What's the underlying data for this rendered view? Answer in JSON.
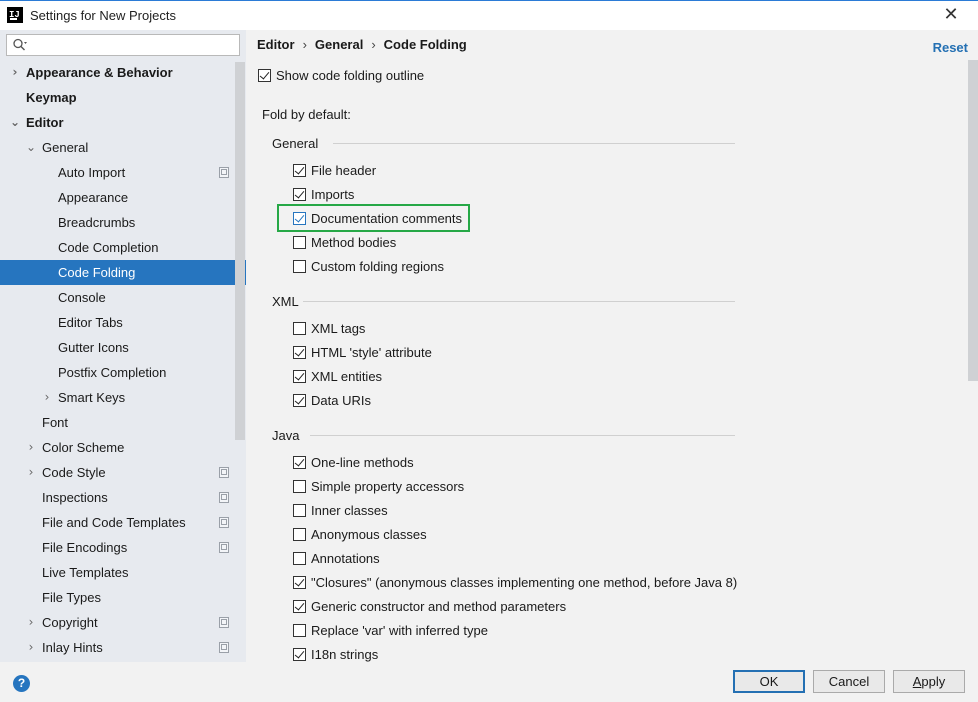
{
  "window": {
    "title": "Settings for New Projects",
    "close_glyph": "✕",
    "app_icon_text": "IJ"
  },
  "search": {
    "placeholder": ""
  },
  "tree": [
    {
      "label": "Appearance & Behavior",
      "arrow": "›",
      "bold": true
    },
    {
      "label": "Keymap",
      "bold": true
    },
    {
      "label": "Editor",
      "arrow": "⌄",
      "bold": true
    },
    {
      "label": "General",
      "arrow": "⌄"
    },
    {
      "label": "Auto Import",
      "project_icon": true
    },
    {
      "label": "Appearance"
    },
    {
      "label": "Breadcrumbs"
    },
    {
      "label": "Code Completion"
    },
    {
      "label": "Code Folding",
      "selected": true
    },
    {
      "label": "Console"
    },
    {
      "label": "Editor Tabs"
    },
    {
      "label": "Gutter Icons"
    },
    {
      "label": "Postfix Completion"
    },
    {
      "label": "Smart Keys",
      "arrow": "›"
    },
    {
      "label": "Font"
    },
    {
      "label": "Color Scheme",
      "arrow": "›"
    },
    {
      "label": "Code Style",
      "arrow": "›",
      "project_icon": true
    },
    {
      "label": "Inspections",
      "project_icon": true
    },
    {
      "label": "File and Code Templates",
      "project_icon": true
    },
    {
      "label": "File Encodings",
      "project_icon": true
    },
    {
      "label": "Live Templates"
    },
    {
      "label": "File Types"
    },
    {
      "label": "Copyright",
      "arrow": "›",
      "project_icon": true
    },
    {
      "label": "Inlay Hints",
      "arrow": "›",
      "project_icon": true
    }
  ],
  "breadcrumb": [
    "Editor",
    "General",
    "Code Folding"
  ],
  "breadcrumb_separator": "›",
  "reset_label": "Reset",
  "show_outline": {
    "label": "Show code folding outline",
    "checked": true
  },
  "fold_by_default_label": "Fold by default:",
  "sections": [
    {
      "title": "General",
      "options": [
        {
          "label": "File header",
          "checked": true
        },
        {
          "label": "Imports",
          "checked": true
        },
        {
          "label": "Documentation comments",
          "checked": true,
          "highlighted": true
        },
        {
          "label": "Method bodies",
          "checked": false
        },
        {
          "label": "Custom folding regions",
          "checked": false
        }
      ]
    },
    {
      "title": "XML",
      "options": [
        {
          "label": "XML tags",
          "checked": false
        },
        {
          "label": "HTML 'style' attribute",
          "checked": true
        },
        {
          "label": "XML entities",
          "checked": true
        },
        {
          "label": "Data URIs",
          "checked": true
        }
      ]
    },
    {
      "title": "Java",
      "options": [
        {
          "label": "One-line methods",
          "checked": true
        },
        {
          "label": "Simple property accessors",
          "checked": false
        },
        {
          "label": "Inner classes",
          "checked": false
        },
        {
          "label": "Anonymous classes",
          "checked": false
        },
        {
          "label": "Annotations",
          "checked": false
        },
        {
          "label": "\"Closures\" (anonymous classes implementing one method, before Java 8)",
          "checked": true
        },
        {
          "label": "Generic constructor and method parameters",
          "checked": true
        },
        {
          "label": "Replace 'var' with inferred type",
          "checked": false
        },
        {
          "label": "I18n strings",
          "checked": true
        }
      ]
    }
  ],
  "buttons": {
    "ok": "OK",
    "cancel": "Cancel",
    "apply": "Apply"
  },
  "help_glyph": "?",
  "colors": {
    "accent": "#2675bf",
    "highlight_box": "#26a846",
    "sidebar_bg": "#e7eaef",
    "link": "#2470b3"
  }
}
